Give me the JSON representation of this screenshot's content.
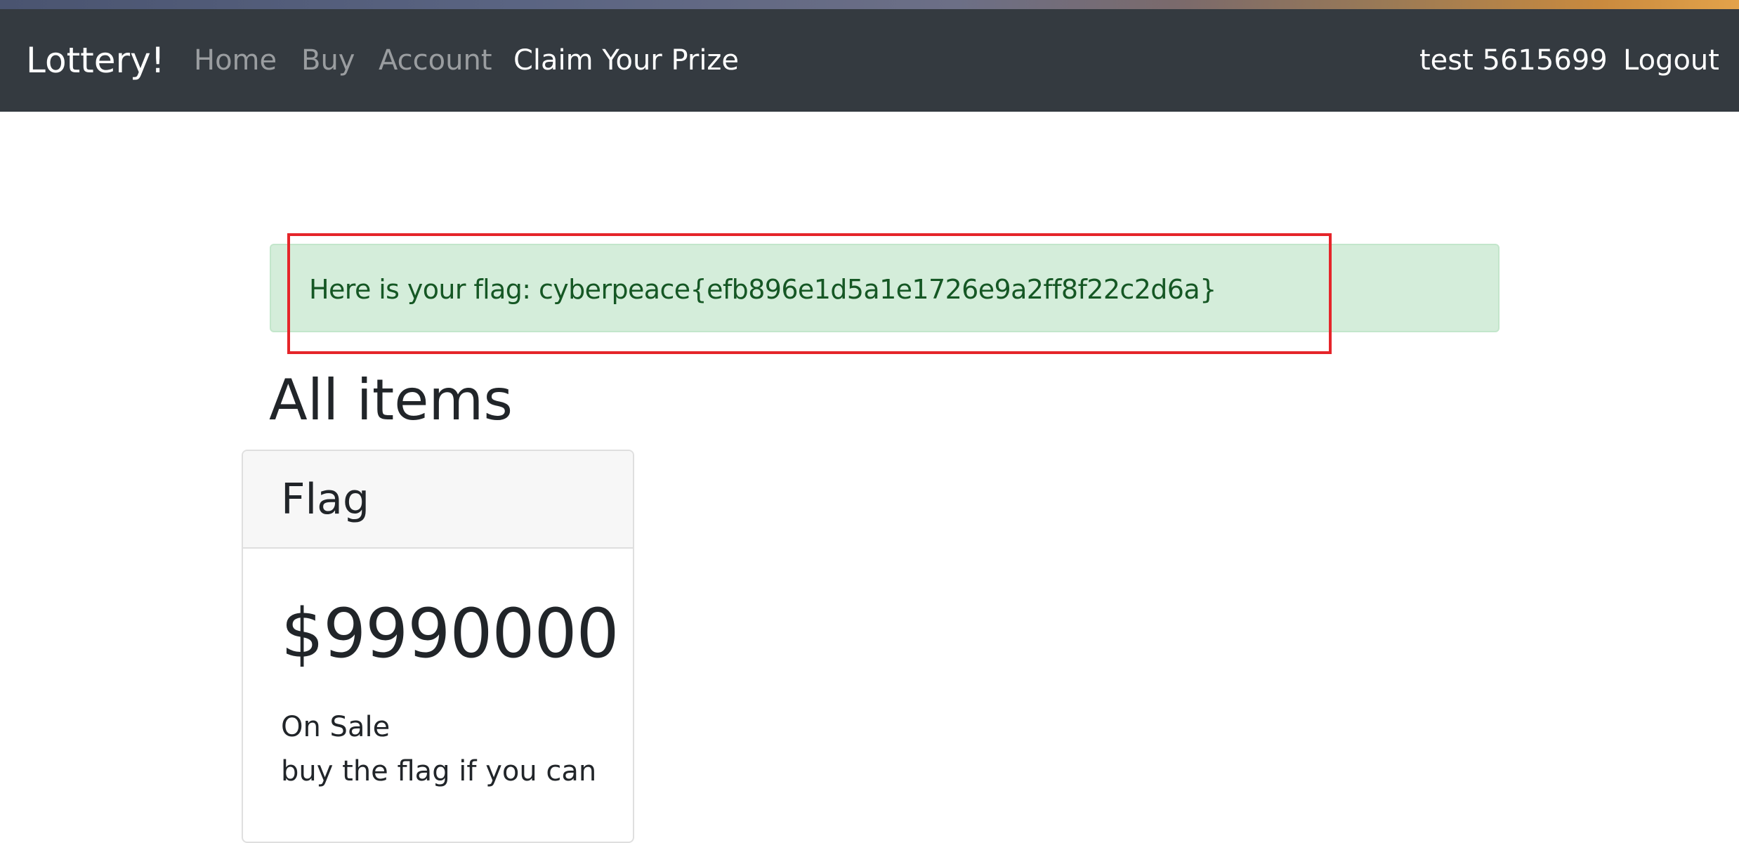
{
  "navbar": {
    "brand": "Lottery!",
    "links": [
      {
        "label": "Home",
        "active": false
      },
      {
        "label": "Buy",
        "active": false
      },
      {
        "label": "Account",
        "active": false
      },
      {
        "label": "Claim Your Prize",
        "active": true
      }
    ],
    "user": "test 5615699",
    "logout": "Logout"
  },
  "alert": {
    "message": "Here is your flag: cyberpeace{efb896e1d5a1e1726e9a2ff8f22c2d6a}",
    "highlight_color": "#e5252a"
  },
  "main": {
    "title": "All items",
    "items": [
      {
        "name": "Flag",
        "price": "$9990000",
        "status": "On Sale",
        "description": "buy the flag if you can"
      }
    ]
  }
}
